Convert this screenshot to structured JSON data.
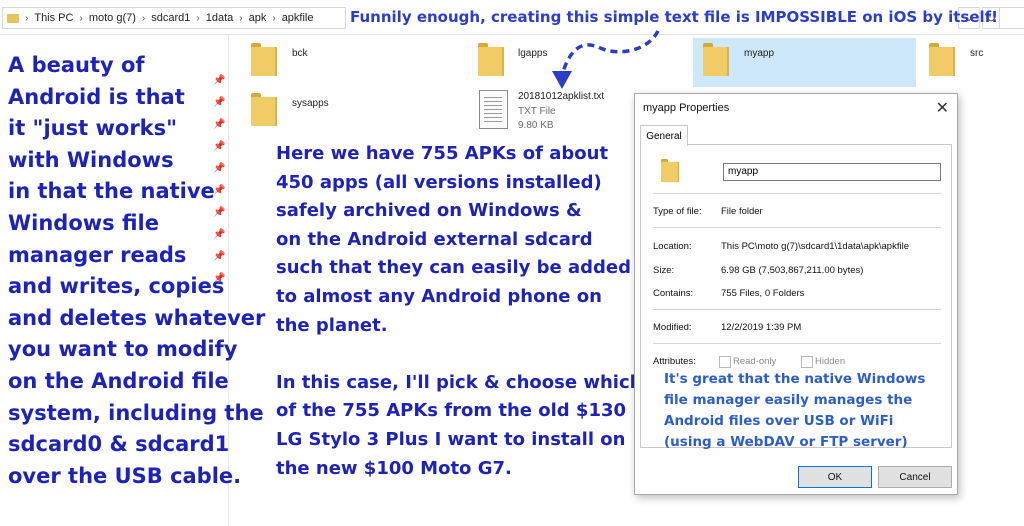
{
  "breadcrumb": [
    "This PC",
    "moto g(7)",
    "sdcard1",
    "1data",
    "apk",
    "apkfile"
  ],
  "headline": "Funnily enough, creating this simple text file is IMPOSSIBLE on iOS by itself!",
  "left_text": [
    "A beauty of",
    "Android is that",
    "it \"just works\"",
    "with Windows",
    "in that the native",
    "Windows file",
    "manager reads",
    "and writes, copies",
    "and deletes whatever",
    "you want to modify",
    "on the Android file",
    "system, including the",
    "sdcard0 & sdcard1",
    "over the USB cable."
  ],
  "files": {
    "bck": "bck",
    "lgapps": "lgapps",
    "myapp": "myapp",
    "src": "src",
    "sysapps": "sysapps",
    "txt_name": "20181012apklist.txt",
    "txt_type": "TXT File",
    "txt_size": "9.80 KB"
  },
  "mid_text_1": [
    "Here we have 755 APKs of about",
    "450 apps (all versions installed)",
    "safely archived on Windows &",
    "on the Android external sdcard",
    "such that they can easily be added",
    "to almost any Android phone on",
    "the planet."
  ],
  "mid_text_2": [
    "In this case, I'll pick & choose which",
    "of the 755 APKs from the old $130",
    "LG Stylo 3 Plus I want to install on",
    "the new $100 Moto G7."
  ],
  "dialog": {
    "title": "myapp Properties",
    "close": "✕",
    "tab": "General",
    "name_value": "myapp",
    "type_label": "Type of file:",
    "type_value": "File folder",
    "location_label": "Location:",
    "location_value": "This PC\\moto g(7)\\sdcard1\\1data\\apk\\apkfile",
    "size_label": "Size:",
    "size_value": "6.98 GB (7,503,867,211.00 bytes)",
    "contains_label": "Contains:",
    "contains_value": "755 Files, 0 Folders",
    "modified_label": "Modified:",
    "modified_value": "12/2/2019 1:39 PM",
    "attributes_label": "Attributes:",
    "readonly_label": "Read-only",
    "hidden_label": "Hidden",
    "ok": "OK",
    "cancel": "Cancel"
  },
  "dialog_text": [
    "It's great that the native Windows",
    "file manager easily manages the",
    "Android files over USB or WiFi",
    "(using a WebDAV or FTP server)"
  ],
  "colors": {
    "main_text": "#1e23b8",
    "dialog_text": "#2d5ec7",
    "folder": "#f0cb66",
    "selection": "#cde8fa"
  },
  "icons": [
    "folder-icon",
    "text-file-icon",
    "pin-icon",
    "chevron-right-icon",
    "chevron-down-icon",
    "refresh-icon",
    "close-icon"
  ]
}
